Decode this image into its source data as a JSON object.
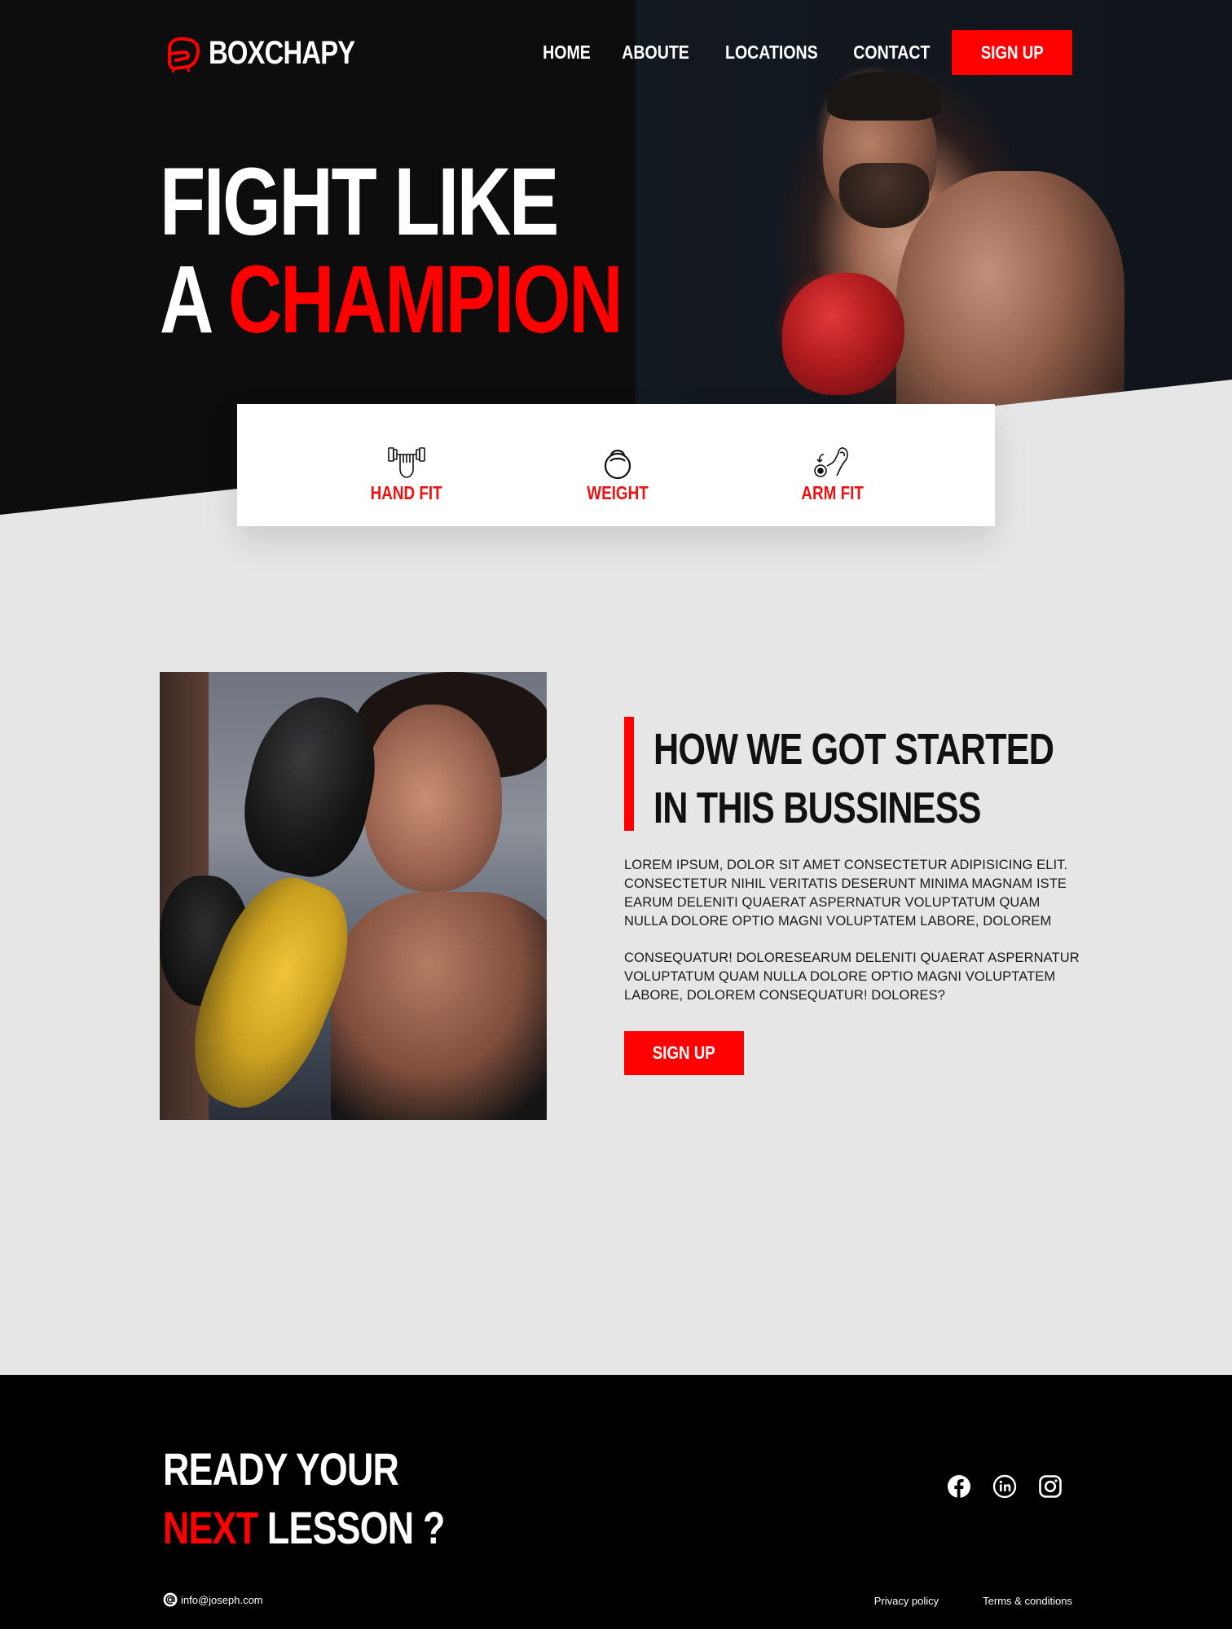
{
  "brand": {
    "name": "BOXCHAPY",
    "logo_icon": "boxing-glove-icon",
    "accent_color": "#ff0000"
  },
  "nav": {
    "links": [
      {
        "label": "HOME"
      },
      {
        "label": "ABOUTE"
      },
      {
        "label": "LOCATIONS"
      },
      {
        "label": "CONTACT"
      }
    ],
    "signup_label": "SIGN UP"
  },
  "hero": {
    "line1": "FIGHT LIKE",
    "line2_prefix": "A ",
    "line2_highlight": "CHAMPION"
  },
  "features": [
    {
      "label": "HAND FIT",
      "icon": "dumbbell-hand-icon"
    },
    {
      "label": "WEIGHT",
      "icon": "kettlebell-icon"
    },
    {
      "label": "ARM FIT",
      "icon": "flexed-arm-icon"
    }
  ],
  "about": {
    "heading_line1": "HOW WE GOT STARTED",
    "heading_line2": "IN THIS BUSSINESS",
    "paragraph1": "Lorem ipsum, dolor sit amet consectetur adipisicing elit. Consectetur nihil veritatis deserunt minima magnam iste earum deleniti quaerat aspernatur voluptatum quam nulla dolore optio magni voluptatem labore, dolorem",
    "paragraph2": "consequatur! Doloresearum deleniti quaerat aspernatur voluptatum quam nulla dolore optio magni voluptatem labore, dolorem consequatur! Dolores?",
    "signup_label": "SIGN UP"
  },
  "footer": {
    "cta_line1": "READY YOUR",
    "cta_highlight": "NEXT",
    "cta_line2_rest": " LESSON ?",
    "socials": [
      {
        "icon": "facebook-icon"
      },
      {
        "icon": "linkedin-icon"
      },
      {
        "icon": "instagram-icon"
      }
    ],
    "email": "info@joseph.com",
    "links": [
      {
        "label": "Privacy policy"
      },
      {
        "label": "Terms & conditions"
      }
    ]
  }
}
